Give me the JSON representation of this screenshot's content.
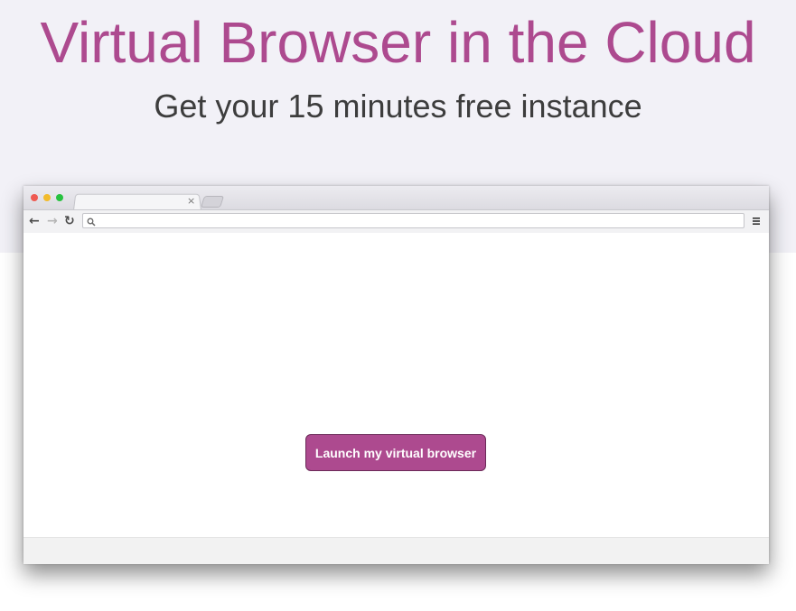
{
  "hero": {
    "title": "Virtual Browser in the Cloud",
    "subtitle": "Get your 15 minutes free instance"
  },
  "browser": {
    "tab": {
      "close_glyph": "×"
    },
    "toolbar": {
      "back_icon": "back-arrow-icon",
      "forward_icon": "forward-arrow-icon",
      "reload_icon": "reload-icon",
      "search_icon": "search-icon",
      "menu_icon": "hamburger-menu-icon",
      "back_glyph": "←",
      "forward_glyph": "→",
      "reload_glyph": "↻"
    },
    "address_bar": {
      "value": ""
    },
    "window_controls": {
      "close_color": "#ef5a52",
      "minimize_color": "#f2bb2c",
      "maximize_color": "#27c23f"
    }
  },
  "launch_button": {
    "label": "Launch my virtual browser"
  },
  "colors": {
    "accent": "#ad4a8f",
    "hero_background": "#f2f1f7",
    "subtitle_text": "#3d3d3d"
  }
}
